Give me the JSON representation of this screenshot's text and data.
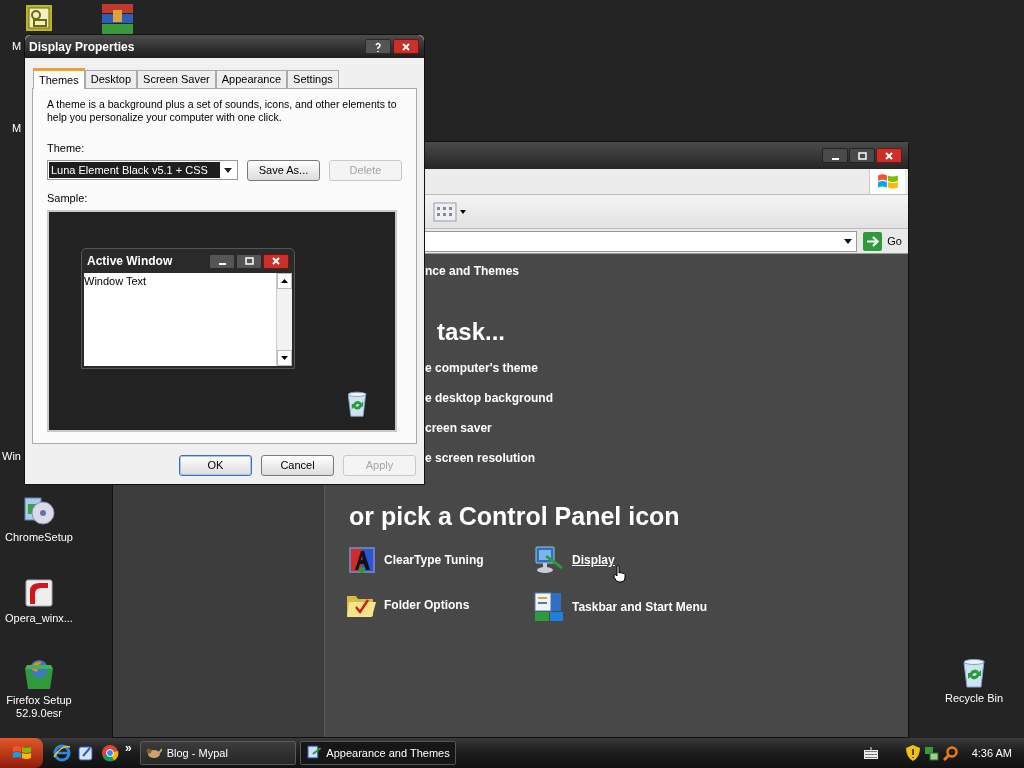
{
  "desktop": {
    "cut_labels": [
      "M",
      "M",
      "Win"
    ],
    "icons": [
      {
        "label": "ChromeSetup"
      },
      {
        "label": "Opera_winx..."
      },
      {
        "label": "Firefox Setup 52.9.0esr"
      },
      {
        "label": "Recycle Bin"
      }
    ]
  },
  "explorer": {
    "go_label": "Go",
    "breadcrumb": "nce and Themes",
    "task_heading": "task...",
    "tasks": [
      "e computer's theme",
      "e desktop background",
      "creen saver",
      "e screen resolution"
    ],
    "icon_heading": "or pick a Control Panel icon",
    "icons": [
      {
        "label": "ClearType Tuning",
        "hovered": false
      },
      {
        "label": "Display",
        "hovered": true
      },
      {
        "label": "Folder Options",
        "hovered": false
      },
      {
        "label": "Taskbar and Start Menu",
        "hovered": false
      }
    ]
  },
  "dialog": {
    "title": "Display Properties",
    "tabs": [
      {
        "label": "Themes",
        "selected": true
      },
      {
        "label": "Desktop",
        "selected": false
      },
      {
        "label": "Screen Saver",
        "selected": false
      },
      {
        "label": "Appearance",
        "selected": false
      },
      {
        "label": "Settings",
        "selected": false
      }
    ],
    "description": "A theme is a background plus a set of sounds, icons, and other elements to help you personalize your computer with one click.",
    "theme_label": "Theme:",
    "theme_value": "Luna Element Black v5.1 + CSS",
    "theme_buttons": [
      {
        "label": "Save As...",
        "disabled": false
      },
      {
        "label": "Delete",
        "disabled": true
      }
    ],
    "sample_label": "Sample:",
    "sample_window": {
      "title": "Active Window",
      "text": "Window Text"
    },
    "buttons": [
      {
        "label": "OK",
        "default": true,
        "disabled": false
      },
      {
        "label": "Cancel",
        "default": false,
        "disabled": false
      },
      {
        "label": "Apply",
        "default": false,
        "disabled": true
      }
    ]
  },
  "taskbar": {
    "chevron": "»",
    "tasks": [
      {
        "label": "Blog - Mypal",
        "selected": false
      },
      {
        "label": "Appearance and Themes",
        "selected": true
      }
    ],
    "clock": "4:36 AM"
  }
}
